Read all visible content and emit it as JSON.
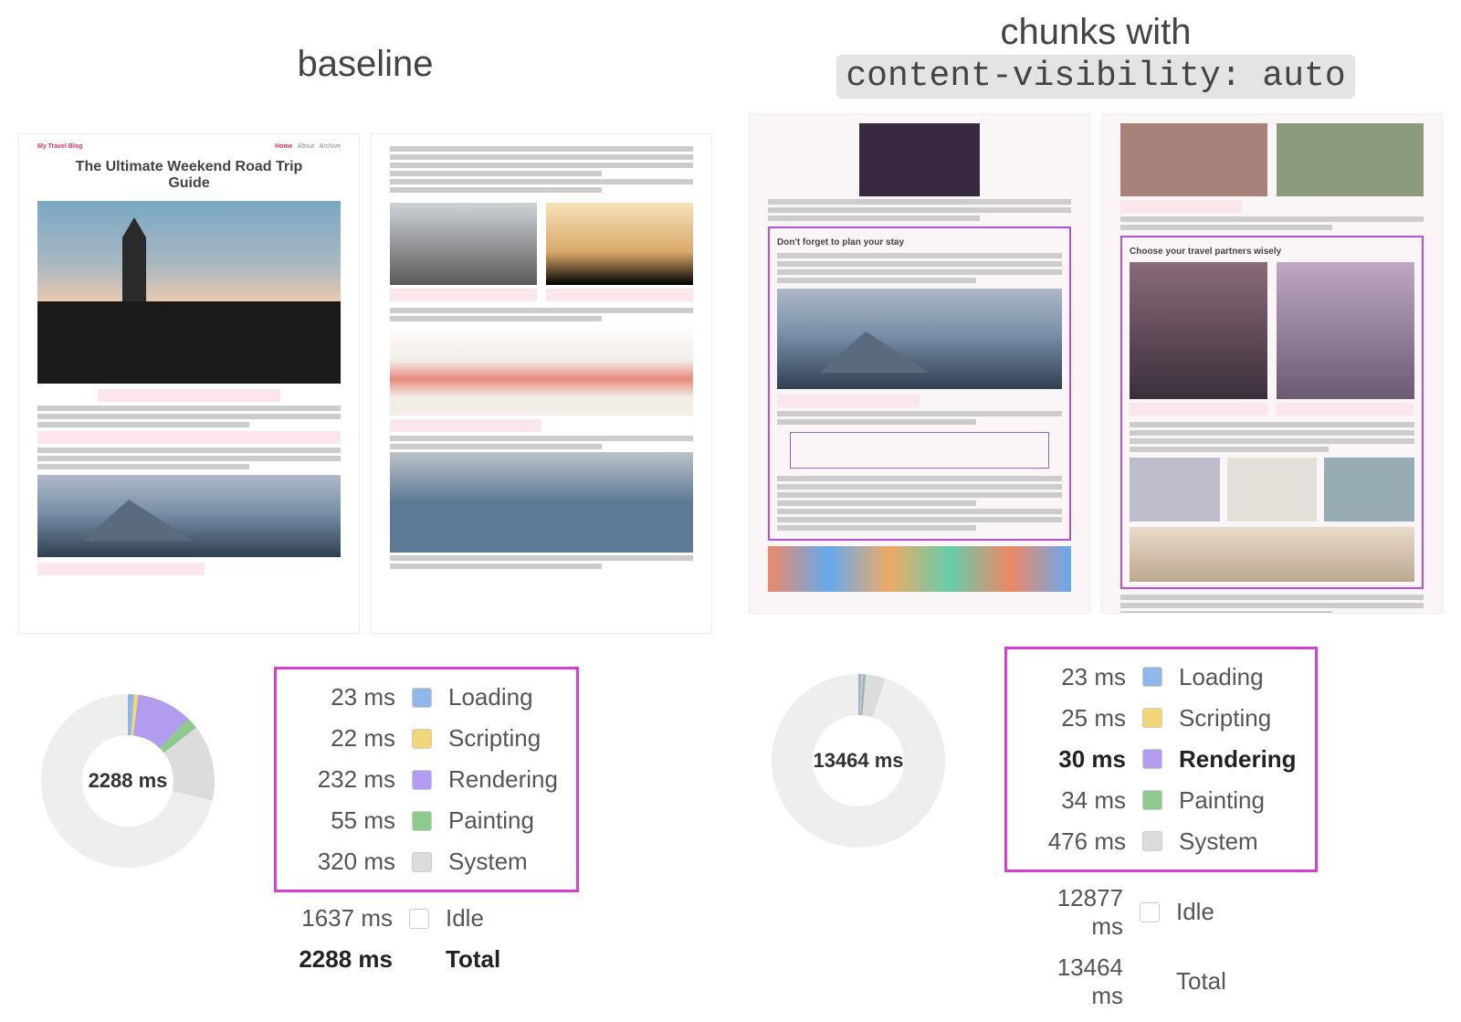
{
  "left": {
    "title": "baseline",
    "blog": {
      "brand": "My Travel Blog",
      "nav": [
        "Home",
        "About",
        "Archive"
      ],
      "post_title": "The Ultimate Weekend Road Trip Guide"
    }
  },
  "right": {
    "title_line1": "chunks with",
    "title_code": "content-visibility: auto",
    "section_a": "Don't forget to plan your stay",
    "section_b": "Choose your travel partners wisely"
  },
  "colors": {
    "loading": "#8fb7e8",
    "scripting": "#f2d67a",
    "rendering": "#b19cf0",
    "painting": "#8ec98e",
    "system": "#dcdcdc",
    "idle": "#ffffff",
    "highlight": "#d63fd6"
  },
  "chart_data": [
    {
      "type": "pie",
      "title": "baseline",
      "center_label": "2288 ms",
      "series": [
        {
          "name": "Loading",
          "value_ms": 23,
          "color": "#8fb7e8"
        },
        {
          "name": "Scripting",
          "value_ms": 22,
          "color": "#f2d67a"
        },
        {
          "name": "Rendering",
          "value_ms": 232,
          "color": "#b19cf0"
        },
        {
          "name": "Painting",
          "value_ms": 55,
          "color": "#8ec98e"
        },
        {
          "name": "System",
          "value_ms": 320,
          "color": "#dcdcdc"
        },
        {
          "name": "Idle",
          "value_ms": 1637,
          "color": "#eeeeee"
        }
      ],
      "total_label": "Total",
      "total_ms": 2288,
      "idle_label": "Idle",
      "idle_ms": 1637,
      "emphasize": null
    },
    {
      "type": "pie",
      "title": "chunks with content-visibility: auto",
      "center_label": "13464 ms",
      "series": [
        {
          "name": "Loading",
          "value_ms": 23,
          "color": "#8fb7e8"
        },
        {
          "name": "Scripting",
          "value_ms": 25,
          "color": "#f2d67a"
        },
        {
          "name": "Rendering",
          "value_ms": 30,
          "color": "#b19cf0"
        },
        {
          "name": "Painting",
          "value_ms": 34,
          "color": "#8ec98e"
        },
        {
          "name": "System",
          "value_ms": 476,
          "color": "#dcdcdc"
        },
        {
          "name": "Idle",
          "value_ms": 12877,
          "color": "#eeeeee"
        }
      ],
      "total_label": "Total",
      "total_ms": 13464,
      "idle_label": "Idle",
      "idle_ms": 12877,
      "emphasize": "Rendering"
    }
  ]
}
